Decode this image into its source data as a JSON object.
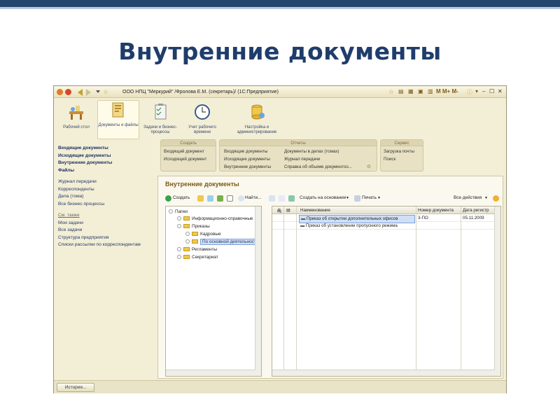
{
  "slide": {
    "title": "Внутренние документы"
  },
  "window": {
    "title": "ООО НПЦ \"Меркурий\" /Фролова Е.М. (секретарь)/  (1С:Предприятие)",
    "title_right": "M  M+  M-"
  },
  "sections": [
    {
      "label": "Рабочий стол",
      "icon": "desk-icon"
    },
    {
      "label": "Документы и файлы",
      "icon": "documents-icon"
    },
    {
      "label": "Задачи и бизнес-процессы",
      "icon": "tasks-icon"
    },
    {
      "label": "Учет рабочего времени",
      "icon": "clock-icon"
    },
    {
      "label": "Настройка и администрирование",
      "icon": "settings-icon"
    }
  ],
  "sidebar": {
    "main": [
      "Входящие документы",
      "Исходящие документы",
      "Внутренние документы",
      "Файлы"
    ],
    "links": [
      "Журнал передачи",
      "Корреспонденты",
      "Дела (тома)",
      "Все бизнес-процессы"
    ],
    "see_also_title": "См. также",
    "see_also": [
      "Мои задачи",
      "Все задачи",
      "Структура предприятия",
      "Списки рассылки по корреспондентам"
    ]
  },
  "groups": {
    "create": {
      "title": "Создать",
      "items": [
        "Входящий документ",
        "Исходящий документ"
      ]
    },
    "reports": {
      "title": "Отчеты",
      "col1": [
        "Входящие документы",
        "Исходящие документы",
        "Внутренние документы"
      ],
      "col2": [
        "Документы в делах (томах)",
        "Журнал передачи",
        "Справка об объеме документоо..."
      ]
    },
    "service": {
      "title": "Сервис",
      "items": [
        "Загрузка почты",
        "Поиск"
      ]
    }
  },
  "content": {
    "title": "Внутренние документы",
    "toolbar": {
      "create": "Создать",
      "find": "Найти...",
      "create_based": "Создать на основании",
      "print": "Печать",
      "all_actions": "Все действия"
    },
    "tree": {
      "root": "Папки",
      "items": [
        "Информационно-справочные",
        "Приказы",
        "Кадровые",
        "По основной деятельности",
        "Регламенты",
        "Секретариат"
      ]
    },
    "list": {
      "headers": {
        "name": "Наименование",
        "number": "Номер документа",
        "date": "Дата регистр"
      },
      "rows": [
        {
          "name": "Приказ об открытии дополнительных офисов",
          "number": "3-ПО",
          "date": "05.11.2009"
        },
        {
          "name": "Приказ об установлении пропускного режима",
          "number": "",
          "date": ""
        }
      ]
    }
  },
  "statusbar": {
    "history": "История..."
  }
}
